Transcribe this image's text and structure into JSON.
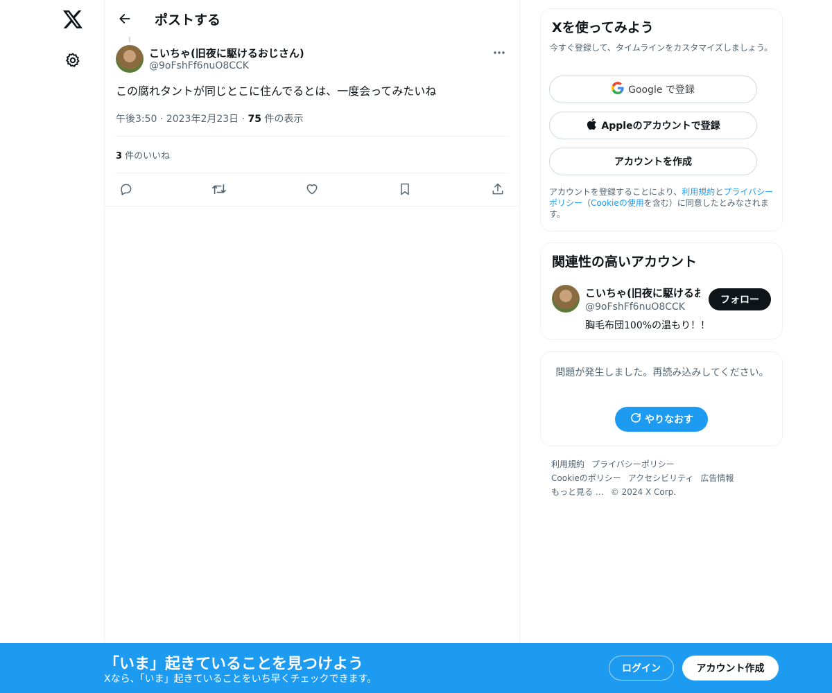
{
  "header": {
    "title": "ポストする"
  },
  "post": {
    "author_name": "こいちゃ(旧夜に駆けるおじさん)",
    "author_handle": "@9oFshFf6nuO8CCK",
    "text": "この腐れタントが同じとこに住んでるとは、一度会ってみたいね",
    "time": "午後3:50",
    "date": "2023年2月23日",
    "views_count": "75",
    "views_label": " 件の表示",
    "likes_count": "3",
    "likes_label": " 件のいいね"
  },
  "signup": {
    "title": "Xを使ってみよう",
    "subtitle": "今すぐ登録して、タイムラインをカスタマイズしましょう。",
    "google_label": "Google で登録",
    "apple_label": "Appleのアカウントで登録",
    "create_label": "アカウントを作成",
    "legal_pre": "アカウントを登録することにより、",
    "legal_terms": "利用規約",
    "legal_and": "と",
    "legal_privacy": "プライバシーポリシー",
    "legal_open": "（",
    "legal_cookie": "Cookieの使用",
    "legal_post": "を含む）に同意したとみなされます。"
  },
  "related": {
    "title": "関連性の高いアカウント",
    "name": "こいちゃ(旧夜に駆けるおじさん)",
    "handle": "@9oFshFf6nuO8CCK",
    "bio": "胸毛布団100%の温もり！！",
    "follow_label": "フォロー"
  },
  "error": {
    "message": "問題が発生しました。再読み込みしてください。",
    "retry_label": "やりなおす"
  },
  "footer": {
    "terms": "利用規約",
    "privacy": "プライバシーポリシー",
    "cookie": "Cookieのポリシー",
    "accessibility": "アクセシビリティ",
    "ads": "広告情報",
    "more": "もっと見る …",
    "copyright": "© 2024 X Corp."
  },
  "bottom_bar": {
    "title": "「いま」起きていることを見つけよう",
    "subtitle": "Xなら、「いま」起きていることをいち早くチェックできます。",
    "login_label": "ログイン",
    "create_label": "アカウント作成"
  },
  "colors": {
    "accent": "#1d9bf0",
    "text": "#0f1419",
    "muted": "#536471",
    "border": "#eff3f4"
  },
  "icons": [
    "x-logo-icon",
    "gear-icon",
    "back-arrow-icon",
    "more-icon",
    "reply-icon",
    "repost-icon",
    "like-icon",
    "bookmark-icon",
    "share-icon",
    "google-icon",
    "apple-icon",
    "refresh-icon"
  ]
}
